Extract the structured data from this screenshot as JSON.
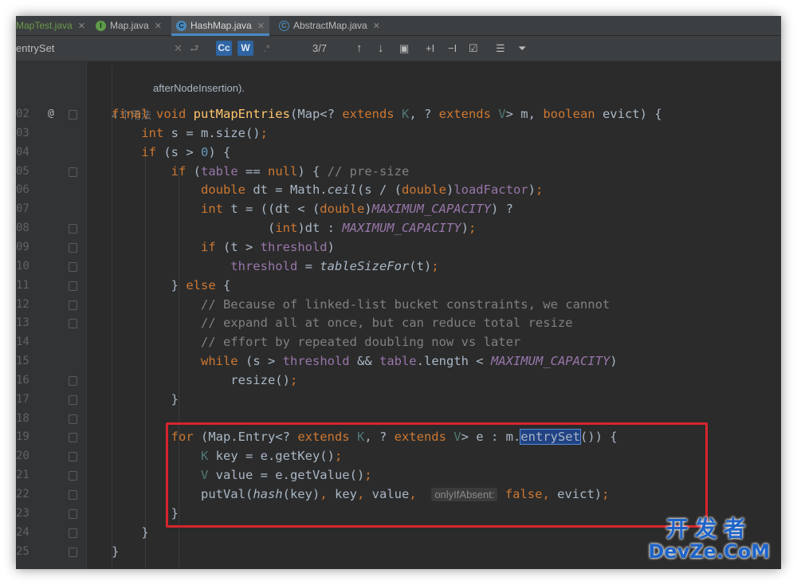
{
  "tabs": [
    {
      "label": "MapTest.java",
      "icon": "java-file-icon",
      "active": false
    },
    {
      "label": "Map.java",
      "icon": "interface-icon",
      "active": false
    },
    {
      "label": "HashMap.java",
      "icon": "class-icon",
      "active": true
    },
    {
      "label": "AbstractMap.java",
      "icon": "abstract-class-icon",
      "active": false
    }
  ],
  "find": {
    "query": "entrySet",
    "match_case": "Cc",
    "words": "W",
    "regex": ".*",
    "counter": "3/7"
  },
  "colors": {
    "accent": "#4a88c7",
    "highlight_box": "#d6252c",
    "selection": "#214283"
  },
  "editor": {
    "wrapped_line": "afterNodeInsertion).",
    "usages": "4 个用法",
    "gutter_annotation": "@",
    "line_numbers": [
      "02",
      "03",
      "04",
      "05",
      "06",
      "07",
      "08",
      "09",
      "10",
      "11",
      "12",
      "13",
      "14",
      "15",
      "16",
      "17",
      "18",
      "19",
      "20",
      "21",
      "22",
      "23",
      "24",
      "25"
    ],
    "lines": [
      {
        "parts": [
          [
            "kw",
            "final void "
          ],
          [
            "fn",
            "putMapEntries"
          ],
          [
            "",
            "(Map<? "
          ],
          [
            "kw",
            "extends "
          ],
          [
            "tp",
            "K"
          ],
          [
            "",
            ", ? "
          ],
          [
            "kw",
            "extends "
          ],
          [
            "tp",
            "V"
          ],
          [
            "",
            "> m, "
          ],
          [
            "kw",
            "boolean "
          ],
          [
            "",
            "evict) {"
          ]
        ]
      },
      {
        "parts": [
          [
            "kw",
            "    int "
          ],
          [
            "",
            "s = m.size()"
          ],
          [
            "kw",
            ";"
          ]
        ]
      },
      {
        "parts": [
          [
            "kw",
            "    if "
          ],
          [
            "",
            "(s > "
          ],
          [
            "num",
            "0"
          ],
          [
            "",
            ") {"
          ]
        ]
      },
      {
        "parts": [
          [
            "kw",
            "        if "
          ],
          [
            "",
            "("
          ],
          [
            "fld",
            "table"
          ],
          [
            "",
            " == "
          ],
          [
            "kw",
            "null"
          ],
          [
            "",
            ") { "
          ],
          [
            "cm",
            "// pre-size"
          ]
        ]
      },
      {
        "parts": [
          [
            "kw",
            "            double "
          ],
          [
            "",
            "dt = Math."
          ],
          [
            "ital",
            "ceil"
          ],
          [
            "",
            "(s / ("
          ],
          [
            "kw",
            "double"
          ],
          [
            "",
            ")"
          ],
          [
            "fld",
            "loadFactor"
          ],
          [
            "",
            ")"
          ],
          [
            "kw",
            ";"
          ]
        ]
      },
      {
        "parts": [
          [
            "kw",
            "            int "
          ],
          [
            "",
            "t = ((dt < ("
          ],
          [
            "kw",
            "double"
          ],
          [
            "",
            ")"
          ],
          [
            "cst",
            "MAXIMUM_CAPACITY"
          ],
          [
            "",
            ") ?"
          ]
        ]
      },
      {
        "parts": [
          [
            "",
            "                     ("
          ],
          [
            "kw",
            "int"
          ],
          [
            "",
            ")dt : "
          ],
          [
            "cst",
            "MAXIMUM_CAPACITY"
          ],
          [
            "",
            ")"
          ],
          [
            "kw",
            ";"
          ]
        ]
      },
      {
        "parts": [
          [
            "kw",
            "            if "
          ],
          [
            "",
            "(t > "
          ],
          [
            "fld",
            "threshold"
          ],
          [
            "",
            ")"
          ]
        ]
      },
      {
        "parts": [
          [
            "fld",
            "                threshold"
          ],
          [
            "",
            " = "
          ],
          [
            "ital",
            "tableSizeFor"
          ],
          [
            "",
            "(t)"
          ],
          [
            "kw",
            ";"
          ]
        ]
      },
      {
        "parts": [
          [
            "",
            "        } "
          ],
          [
            "kw",
            "else "
          ],
          [
            "",
            "{"
          ]
        ]
      },
      {
        "parts": [
          [
            "cm",
            "            // Because of linked-list bucket constraints, we cannot"
          ]
        ]
      },
      {
        "parts": [
          [
            "cm",
            "            // expand all at once, but can reduce total resize"
          ]
        ]
      },
      {
        "parts": [
          [
            "cm",
            "            // effort by repeated doubling now vs later"
          ]
        ]
      },
      {
        "parts": [
          [
            "kw",
            "            while "
          ],
          [
            "",
            "(s > "
          ],
          [
            "fld",
            "threshold "
          ],
          [
            "",
            "&& "
          ],
          [
            "fld",
            "table"
          ],
          [
            "",
            ".length < "
          ],
          [
            "cst",
            "MAXIMUM_CAPACITY"
          ],
          [
            "",
            ")"
          ]
        ]
      },
      {
        "parts": [
          [
            "",
            "                resize()"
          ],
          [
            "kw",
            ";"
          ]
        ]
      },
      {
        "parts": [
          [
            "",
            "        }"
          ]
        ]
      },
      {
        "parts": [
          [
            "",
            ""
          ]
        ]
      },
      {
        "parts": [
          [
            "kw",
            "        for "
          ],
          [
            "",
            "(Map.Entry<? "
          ],
          [
            "kw",
            "extends "
          ],
          [
            "tp",
            "K"
          ],
          [
            "",
            ", ? "
          ],
          [
            "kw",
            "extends "
          ],
          [
            "tp",
            "V"
          ],
          [
            "",
            "> e : m."
          ],
          [
            "sel",
            "entrySet"
          ],
          [
            "",
            "()) {"
          ]
        ]
      },
      {
        "parts": [
          [
            "tp",
            "            K "
          ],
          [
            "",
            "key = e.getKey()"
          ],
          [
            "kw",
            ";"
          ]
        ]
      },
      {
        "parts": [
          [
            "tp",
            "            V "
          ],
          [
            "",
            "value = e.getValue()"
          ],
          [
            "kw",
            ";"
          ]
        ]
      },
      {
        "parts": [
          [
            "",
            "            putVal("
          ],
          [
            "ital",
            "hash"
          ],
          [
            "",
            "(key)"
          ],
          [
            "kw",
            ", "
          ],
          [
            "",
            "key"
          ],
          [
            "kw",
            ", "
          ],
          [
            "",
            "value"
          ],
          [
            "kw",
            ",  "
          ],
          [
            "hint",
            "onlyIfAbsent:"
          ],
          [
            "kw",
            " false, "
          ],
          [
            "",
            "evict)"
          ],
          [
            "kw",
            ";"
          ]
        ]
      },
      {
        "parts": [
          [
            "",
            "        }"
          ]
        ]
      },
      {
        "parts": [
          [
            "",
            "    }"
          ]
        ]
      },
      {
        "parts": [
          [
            "",
            "}"
          ]
        ]
      }
    ]
  },
  "watermark": {
    "cn": "开发者",
    "en": "DevZe.CoM"
  }
}
